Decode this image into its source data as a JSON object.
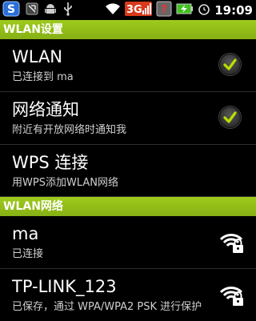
{
  "status_bar": {
    "time": "19:09"
  },
  "wlan_settings": {
    "header": "WLAN设置",
    "items": [
      {
        "title": "WLAN",
        "subtitle": "已连接到 ma",
        "checked": true
      },
      {
        "title": "网络通知",
        "subtitle": "附近有开放网络时通知我",
        "checked": true
      },
      {
        "title": "WPS 连接",
        "subtitle": "用WPS添加WLAN网络"
      }
    ]
  },
  "wlan_networks": {
    "header": "WLAN网络",
    "items": [
      {
        "ssid": "ma",
        "status": "已连接",
        "icon": "wifi-lock-icon"
      },
      {
        "ssid": "TP-LINK_123",
        "status": "已保存，通过 WPA/WPA2 PSK 进行保护",
        "icon": "wifi-lock-icon"
      }
    ]
  },
  "colors": {
    "accent": "#8fb81a",
    "check": "#b8e000"
  }
}
